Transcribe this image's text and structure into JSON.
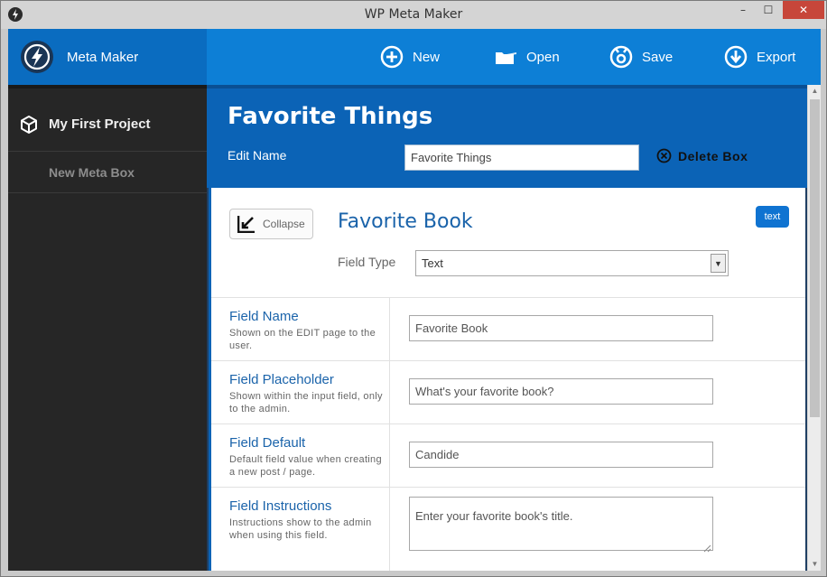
{
  "window": {
    "title": "WP Meta Maker",
    "min": "–",
    "max": "☐",
    "close": "✕"
  },
  "brand": {
    "name": "Meta Maker"
  },
  "toolbar": {
    "new_label": "New",
    "open_label": "Open",
    "save_label": "Save",
    "export_label": "Export"
  },
  "sidebar": {
    "project": "My First Project",
    "items": [
      {
        "label": "New Meta Box"
      }
    ]
  },
  "box": {
    "title": "Favorite Things",
    "edit_label": "Edit Name",
    "name_value": "Favorite Things",
    "delete_label": "Delete Box"
  },
  "field": {
    "collapse_label": "Collapse",
    "title": "Favorite Book",
    "badge": "text",
    "type_label": "Field Type",
    "type_value": "Text",
    "rows": [
      {
        "label": "Field Name",
        "desc": "Shown on the EDIT page to the user.",
        "value": "Favorite Book"
      },
      {
        "label": "Field Placeholder",
        "desc": "Shown within the input field, only to the admin.",
        "value": "What's your favorite book?"
      },
      {
        "label": "Field Default",
        "desc": "Default field value when creating a new post / page.",
        "value": "Candide"
      },
      {
        "label": "Field Instructions",
        "desc": "Instructions show to the admin when using this field.",
        "value": "Enter your favorite book's title."
      }
    ]
  },
  "colors": {
    "accent": "#0d7fd6",
    "sidebar": "#262626",
    "danger": "#c7463a"
  }
}
